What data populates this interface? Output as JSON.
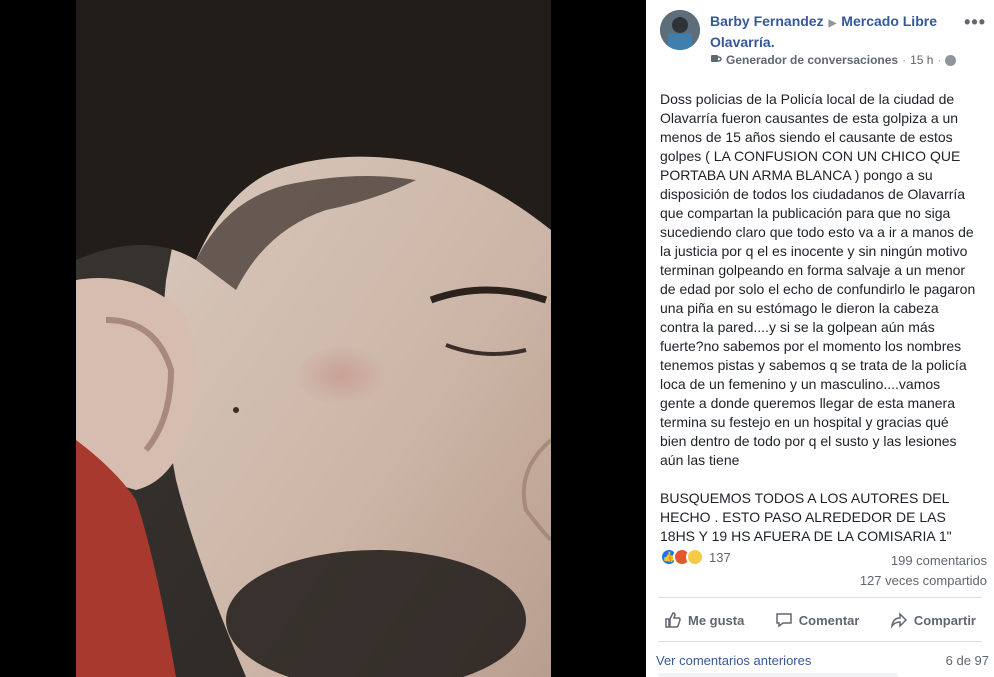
{
  "post": {
    "author": "Barby Fernandez",
    "group": "Mercado Libre Olavarría.",
    "app": "Generador de conversaciones",
    "time": "15 h",
    "text": "Doss policias de la Policía local de la ciudad de Olavarría fueron causantes de esta golpiza a un menos de 15 años siendo el causante de estos golpes ( LA CONFUSION CON UN CHICO QUE PORTABA UN ARMA BLANCA ) pongo a su disposición de todos los ciudadanos de Olavarría que compartan la publicación para que no siga sucediendo claro que todo esto va a ir a manos de la justicia por q el es inocente y sin ningún motivo terminan golpeando en forma salvaje a un menor de edad por solo el echo de confundirlo le pagaron una piña en su estómago le dieron la cabeza contra la pared....y si se la golpean aún más fuerte?no sabemos por el momento los nombres tenemos pistas y sabemos q se trata de la policía loca de un femenino y un masculino....vamos gente a donde queremos llegar de esta manera termina su festejo en un hospital y gracias qué bien dentro de todo por q el susto y las lesiones aún las tiene\n\nBUSQUEMOS TODOS A LOS AUTORES DEL HECHO . ESTO PASO ALREDEDOR DE LAS 18HS Y 19 HS AFUERA DE LA COMISARIA 1\""
  },
  "stats": {
    "reactions_count": "137",
    "comments": "199 comentarios",
    "shares": "127 veces compartido"
  },
  "actions": {
    "like": "Me gusta",
    "comment": "Comentar",
    "share": "Compartir"
  },
  "comments": {
    "previous_link": "Ver comentarios anteriores",
    "pager": "6 de 97"
  },
  "icons": {
    "more": "more-options-icon",
    "app": "coffee-cup-icon",
    "privacy": "globe-icon",
    "like": "thumbs-up-icon",
    "comment": "speech-bubble-icon",
    "share": "share-arrow-icon"
  },
  "colors": {
    "link": "#365899",
    "text": "#1d2129",
    "secondary": "#606770",
    "like_blue": "#1877f2"
  }
}
